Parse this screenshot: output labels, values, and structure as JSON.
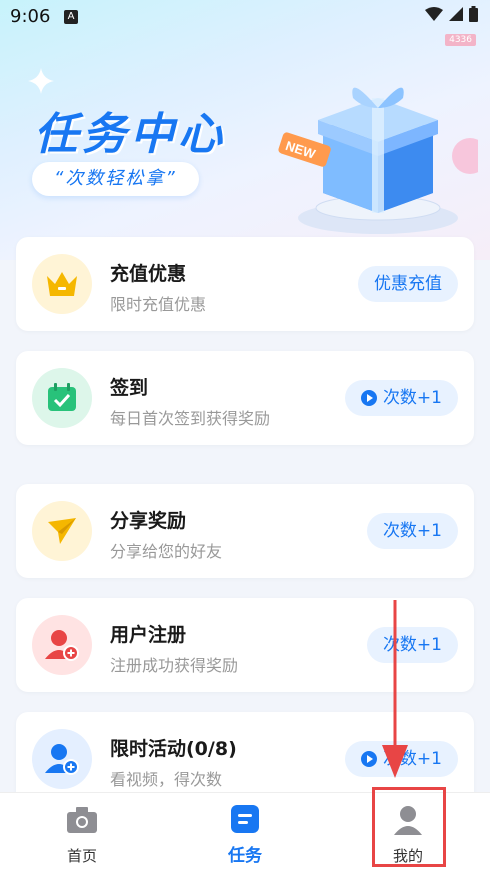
{
  "status_bar": {
    "time": "9:06",
    "a_icon": "A",
    "speed": "4336"
  },
  "hero": {
    "title": "任务中心",
    "subtitle": "“次数轻松拿”",
    "badge": "NEW"
  },
  "tasks": [
    {
      "title": "充值优惠",
      "subtitle": "限时充值优惠",
      "action": "优惠充值",
      "icon": "crown-icon",
      "play": false
    },
    {
      "title": "签到",
      "subtitle": "每日首次签到获得奖励",
      "action": "次数+1",
      "icon": "calendar-check-icon",
      "play": true
    },
    {
      "title": "分享奖励",
      "subtitle": "分享给您的好友",
      "action": "次数+1",
      "icon": "paper-plane-icon",
      "play": false
    },
    {
      "title": "用户注册",
      "subtitle": "注册成功获得奖励",
      "action": "次数+1",
      "icon": "user-add-icon",
      "play": false
    },
    {
      "title": "限时活动(0/8)",
      "subtitle": "看视频，得次数",
      "action": "次数+1",
      "icon": "user-add-icon",
      "play": true
    }
  ],
  "tabbar": {
    "home": "首页",
    "tasks": "任务",
    "mine": "我的"
  },
  "colors": {
    "accent": "#1877f2",
    "highlight": "#e84545"
  }
}
